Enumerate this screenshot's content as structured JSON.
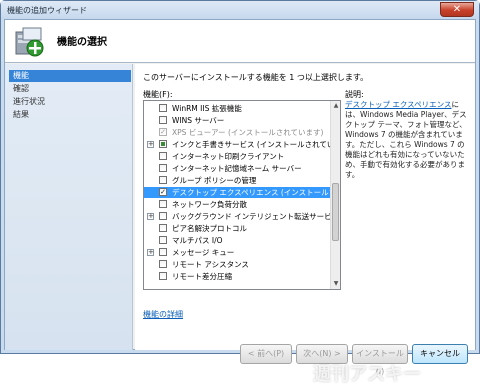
{
  "window": {
    "title": "機能の追加ウィザード",
    "close_label": "✕"
  },
  "header": {
    "title": "機能の選択"
  },
  "steps": [
    {
      "label": "機能",
      "active": true
    },
    {
      "label": "確認",
      "active": false
    },
    {
      "label": "進行状況",
      "active": false
    },
    {
      "label": "結果",
      "active": false
    }
  ],
  "content": {
    "instruction": "このサーバーにインストールする機能を 1 つ以上選択します。",
    "features_label": "機能(F):",
    "description_label": "説明:",
    "more_info_link": "機能の詳細"
  },
  "features": [
    {
      "label": "WinRM IIS 拡張機能",
      "checked": false,
      "expandable": false,
      "disabled": false,
      "selected": false
    },
    {
      "label": "WINS サーバー",
      "checked": false,
      "expandable": false,
      "disabled": false,
      "selected": false
    },
    {
      "label": "XPS ビューアー (インストールされています)",
      "checked": true,
      "expandable": false,
      "disabled": true,
      "selected": false
    },
    {
      "label": "インクと手書きサービス (インストールされてい",
      "checked": "partial",
      "expandable": true,
      "disabled": false,
      "selected": false
    },
    {
      "label": "インターネット印刷クライアント",
      "checked": false,
      "expandable": false,
      "disabled": false,
      "selected": false
    },
    {
      "label": "インターネット記憶域ネーム サーバー",
      "checked": false,
      "expandable": false,
      "disabled": false,
      "selected": false
    },
    {
      "label": "グループ ポリシーの管理",
      "checked": false,
      "expandable": false,
      "disabled": false,
      "selected": false
    },
    {
      "label": "デスクトップ エクスペリエンス (インストールさ",
      "checked": true,
      "expandable": false,
      "disabled": false,
      "selected": true
    },
    {
      "label": "ネットワーク負荷分散",
      "checked": false,
      "expandable": false,
      "disabled": false,
      "selected": false
    },
    {
      "label": "バックグラウンド インテリジェント転送サービス",
      "checked": false,
      "expandable": true,
      "disabled": false,
      "selected": false
    },
    {
      "label": "ピア名解決プロトコル",
      "checked": false,
      "expandable": false,
      "disabled": false,
      "selected": false
    },
    {
      "label": "マルチパス I/O",
      "checked": false,
      "expandable": false,
      "disabled": false,
      "selected": false
    },
    {
      "label": "メッセージ キュー",
      "checked": false,
      "expandable": true,
      "disabled": false,
      "selected": false
    },
    {
      "label": "リモート アシスタンス",
      "checked": false,
      "expandable": false,
      "disabled": false,
      "selected": false
    },
    {
      "label": "リモート差分圧縮",
      "checked": false,
      "expandable": false,
      "disabled": false,
      "selected": false
    }
  ],
  "description": {
    "link": "デスクトップ エクスペリエンス",
    "text": "には、Windows Media Player、デスクトップ テーマ、フォト管理など、Windows 7 の機能が含まれています。ただし、これら Windows 7 の機能はどれも有効になっていないため、手動で有効化する必要があります。"
  },
  "buttons": {
    "back": "< 前へ(P)",
    "next": "次へ(N) >",
    "install": "インストール(I)",
    "cancel": "キャンセル"
  },
  "watermark": "週刊アスキー",
  "colors": {
    "selection": "#3399ff",
    "active_step": "#3584d8",
    "link": "#0b5fb8"
  }
}
